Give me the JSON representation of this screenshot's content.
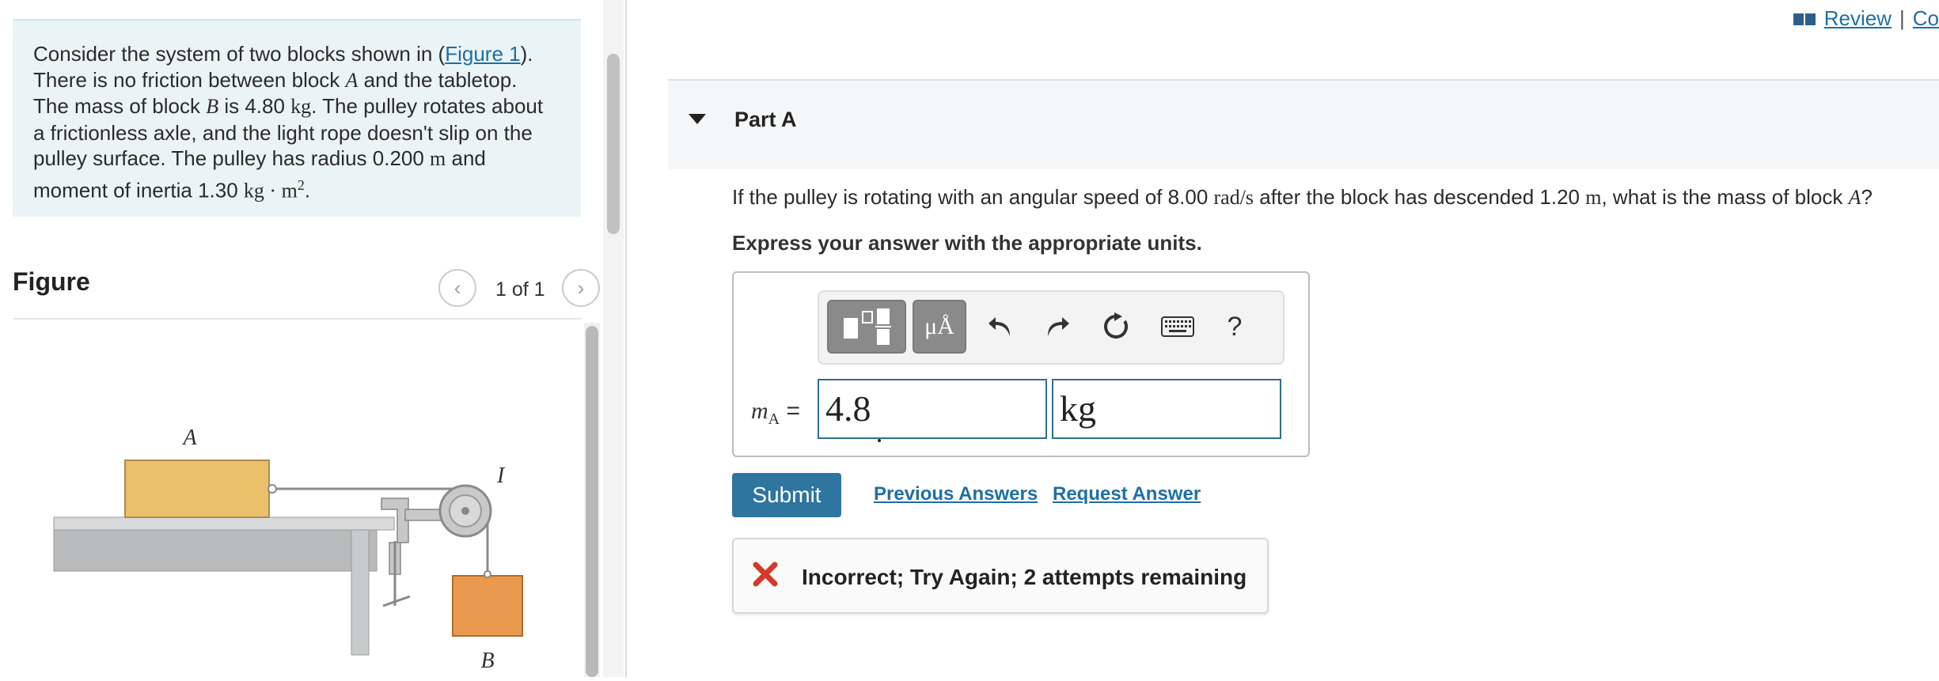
{
  "problem": {
    "line1_pre": "Consider the system of two blocks shown in (",
    "figure_link": "Figure 1",
    "line1_post": ").",
    "line2_pre": "There is no friction between block ",
    "block_a": "A",
    "line2_post": " and the tabletop.",
    "line3_pre": "The mass of block ",
    "block_b": "B",
    "line3_mid": " is 4.80 ",
    "unit_kg": "kg",
    "line3_post": ". The pulley rotates about",
    "line4": "a frictionless axle, and the light rope doesn't slip on the",
    "line5_pre": "pulley surface. The pulley has radius 0.200 ",
    "unit_m": "m",
    "line5_post": " and",
    "line6_pre": "moment of inertia 1.30 ",
    "unit_kgm2": "kg · m",
    "exp2": "2",
    "line6_post": "."
  },
  "figure": {
    "heading": "Figure",
    "counter": "1 of 1",
    "label_a": "A",
    "label_b": "B",
    "label_i": "I"
  },
  "topbar": {
    "review": "Review",
    "separator": "|",
    "continue_partial": "Co"
  },
  "part": {
    "title": "Part A"
  },
  "question": {
    "pre": "If the pulley is rotating with an angular speed of 8.00 ",
    "unit_rad": "rad/s",
    "mid": " after the block has descended 1.20 ",
    "unit_m": "m",
    "post": ", what is the mass of block ",
    "block": "A",
    "end": "?"
  },
  "instruction": "Express your answer with the appropriate units.",
  "toolbar": {
    "units_symbol": "μÅ",
    "help_symbol": "?"
  },
  "answer": {
    "label_var": "m",
    "label_sub": "A",
    "label_eq": " =",
    "value": "4.8",
    "unit": "kg"
  },
  "actions": {
    "submit": "Submit",
    "previous_answers": "Previous Answers",
    "request_answer": "Request Answer"
  },
  "feedback": {
    "text": "Incorrect; Try Again; 2 attempts remaining"
  },
  "colors": {
    "accent": "#2e75a0",
    "link": "#1f6fa3",
    "block_a": "#e8c16a",
    "block_b": "#e99a4e",
    "incorrect": "#d33a2c",
    "problem_bg": "#eaf4f7"
  }
}
